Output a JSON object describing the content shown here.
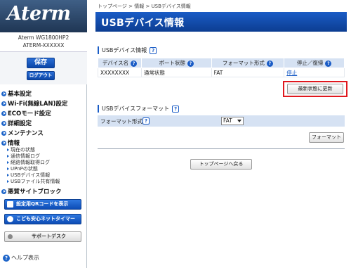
{
  "sidebar": {
    "logo_text": "Aterm",
    "device_model": "Aterm WG1800HP2",
    "device_id": "ATERM-XXXXXX",
    "save_label": "保存",
    "logout_label": "ログアウト",
    "nav": [
      {
        "label": "基本設定"
      },
      {
        "label": "Wi-Fi(無線LAN)設定"
      },
      {
        "label": "ECOモード設定"
      },
      {
        "label": "詳細設定"
      },
      {
        "label": "メンテナンス"
      },
      {
        "label": "情報"
      }
    ],
    "info_sub": [
      {
        "label": "現在の状態"
      },
      {
        "label": "通信情報ログ"
      },
      {
        "label": "経路情報取得ログ"
      },
      {
        "label": "UPnPの状態"
      },
      {
        "label": "USBデバイス情報"
      },
      {
        "label": "USBファイル共有情報"
      }
    ],
    "malicious_block_label": "悪質サイトブロック",
    "qr_button_label": "設定用QRコードを表示",
    "kids_timer_label": "こども安心ネットタイマー",
    "support_label": "サポートデスク",
    "help_label": "ヘルプ表示"
  },
  "breadcrumb": [
    "トップページ",
    ">",
    "情報",
    ">",
    "USBデバイス情報"
  ],
  "page_title": "USBデバイス情報",
  "usb_info": {
    "heading": "USBデバイス情報",
    "columns": [
      "デバイス名",
      "ポート状態",
      "フォーマット形式",
      "停止／復帰"
    ],
    "rows": [
      {
        "device": "XXXXXXXX",
        "port_status": "通常状態",
        "format": "FAT",
        "action": "停止"
      }
    ],
    "refresh_label": "最新状態に更新"
  },
  "usb_format": {
    "heading": "USBデバイスフォーマット",
    "field_label": "フォーマット形式",
    "selected": "FAT",
    "format_button": "フォーマット"
  },
  "top_page_button": "トップページへ戻る",
  "colors": {
    "accent": "#1a5cc6",
    "highlight": "#e0181e",
    "header_bg": "#0c3d91"
  }
}
